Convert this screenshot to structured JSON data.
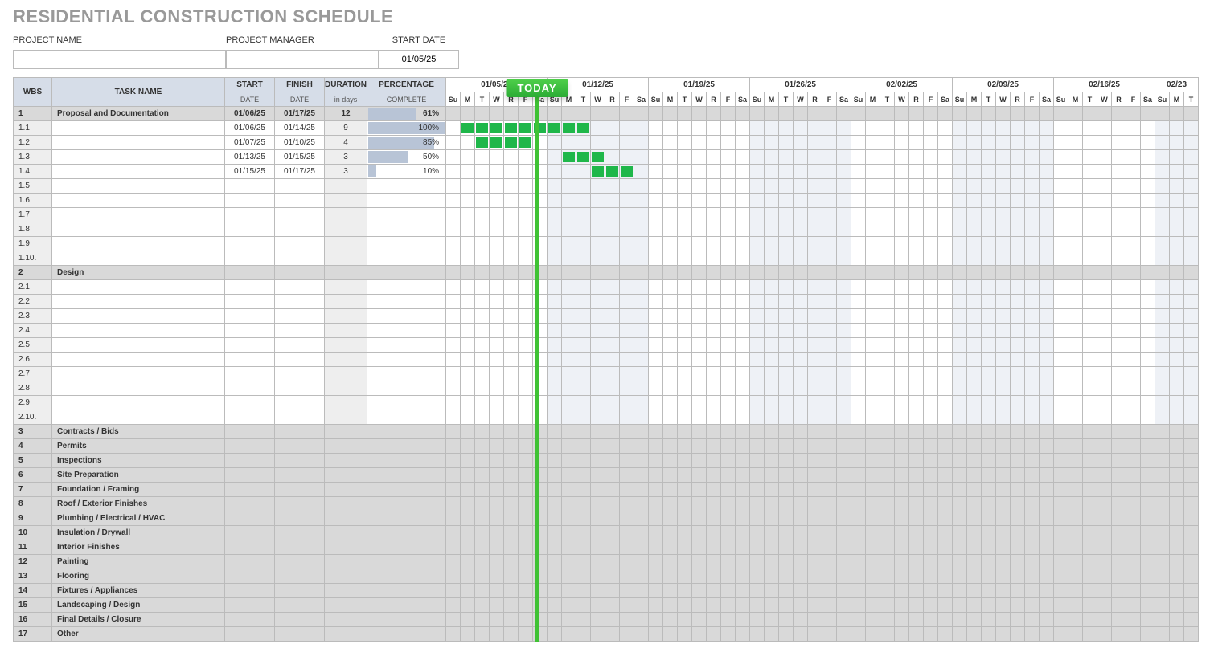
{
  "title": "RESIDENTIAL CONSTRUCTION SCHEDULE",
  "meta": {
    "project_name_label": "PROJECT NAME",
    "project_name": "",
    "project_manager_label": "PROJECT MANAGER",
    "project_manager": "",
    "start_date_label": "START DATE",
    "start_date": "01/05/25"
  },
  "headers": {
    "wbs": "WBS",
    "task": "TASK NAME",
    "start": "START",
    "start_sub": "DATE",
    "finish": "FINISH",
    "finish_sub": "DATE",
    "duration": "DURATION",
    "duration_sub": "in days",
    "pct": "PERCENTAGE",
    "pct_sub": "COMPLETE"
  },
  "today_label": "TODAY",
  "today_day_index": 6,
  "weeks": [
    "01/05/25",
    "01/12/25",
    "01/19/25",
    "01/26/25",
    "02/02/25",
    "02/09/25",
    "02/16/25",
    "02/23"
  ],
  "day_labels": [
    "Su",
    "M",
    "T",
    "W",
    "R",
    "F",
    "Sa"
  ],
  "rows": [
    {
      "wbs": "1",
      "task": "Proposal and Documentation",
      "start": "01/06/25",
      "finish": "01/17/25",
      "dur": "12",
      "pct": 61,
      "section": true
    },
    {
      "wbs": "1.1",
      "task": "",
      "start": "01/06/25",
      "finish": "01/14/25",
      "dur": "9",
      "pct": 100,
      "bar_start": 1,
      "bar_len": 9
    },
    {
      "wbs": "1.2",
      "task": "",
      "start": "01/07/25",
      "finish": "01/10/25",
      "dur": "4",
      "pct": 85,
      "bar_start": 2,
      "bar_len": 4
    },
    {
      "wbs": "1.3",
      "task": "",
      "start": "01/13/25",
      "finish": "01/15/25",
      "dur": "3",
      "pct": 50,
      "bar_start": 8,
      "bar_len": 3
    },
    {
      "wbs": "1.4",
      "task": "",
      "start": "01/15/25",
      "finish": "01/17/25",
      "dur": "3",
      "pct": 10,
      "bar_start": 10,
      "bar_len": 3
    },
    {
      "wbs": "1.5"
    },
    {
      "wbs": "1.6"
    },
    {
      "wbs": "1.7"
    },
    {
      "wbs": "1.8"
    },
    {
      "wbs": "1.9"
    },
    {
      "wbs": "1.10."
    },
    {
      "wbs": "2",
      "task": "Design",
      "section": true
    },
    {
      "wbs": "2.1"
    },
    {
      "wbs": "2.2"
    },
    {
      "wbs": "2.3"
    },
    {
      "wbs": "2.4"
    },
    {
      "wbs": "2.5"
    },
    {
      "wbs": "2.6"
    },
    {
      "wbs": "2.7"
    },
    {
      "wbs": "2.8"
    },
    {
      "wbs": "2.9"
    },
    {
      "wbs": "2.10."
    },
    {
      "wbs": "3",
      "task": "Contracts / Bids",
      "section": true
    },
    {
      "wbs": "4",
      "task": "Permits",
      "section": true
    },
    {
      "wbs": "5",
      "task": "Inspections",
      "section": true
    },
    {
      "wbs": "6",
      "task": "Site Preparation",
      "section": true
    },
    {
      "wbs": "7",
      "task": "Foundation / Framing",
      "section": true
    },
    {
      "wbs": "8",
      "task": "Roof / Exterior Finishes",
      "section": true
    },
    {
      "wbs": "9",
      "task": "Plumbing / Electrical / HVAC",
      "section": true
    },
    {
      "wbs": "10",
      "task": "Insulation / Drywall",
      "section": true
    },
    {
      "wbs": "11",
      "task": "Interior Finishes",
      "section": true
    },
    {
      "wbs": "12",
      "task": "Painting",
      "section": true
    },
    {
      "wbs": "13",
      "task": "Flooring",
      "section": true
    },
    {
      "wbs": "14",
      "task": "Fixtures / Appliances",
      "section": true
    },
    {
      "wbs": "15",
      "task": "Landscaping / Design",
      "section": true
    },
    {
      "wbs": "16",
      "task": "Final Details / Closure",
      "section": true
    },
    {
      "wbs": "17",
      "task": "Other",
      "section": true
    }
  ]
}
